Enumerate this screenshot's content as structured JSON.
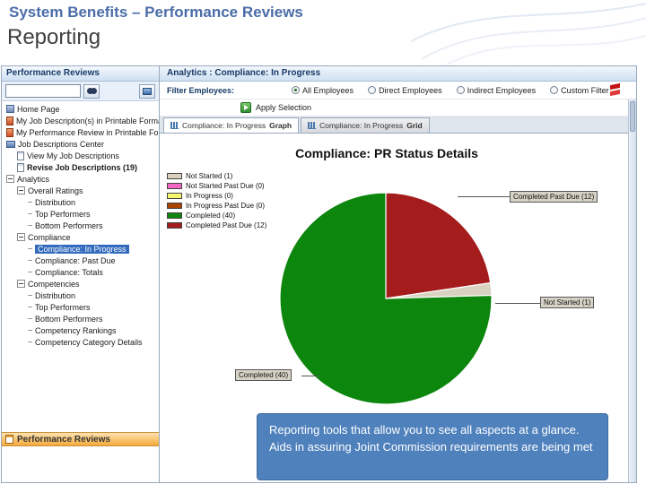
{
  "slide": {
    "title": "System Benefits – Performance Reviews",
    "subtitle": "Reporting",
    "caption": "Reporting tools that allow you to see all aspects at a glance.  Aids in assuring Joint Commission requirements are being met"
  },
  "sidebar": {
    "title": "Performance Reviews",
    "search_value": "",
    "tree": [
      {
        "label": "Home Page",
        "level": 0,
        "icon": "home"
      },
      {
        "label": "My Job Description(s) in Printable Format",
        "level": 0,
        "icon": "doc-red"
      },
      {
        "label": "My Performance Review in Printable Forma",
        "level": 0,
        "icon": "doc-red"
      },
      {
        "label": "Job Descriptions Center",
        "level": 0,
        "icon": "folder"
      },
      {
        "label": "View My Job Descriptions",
        "level": 1,
        "icon": "doc"
      },
      {
        "label": "Revise Job Descriptions (19)",
        "level": 1,
        "icon": "doc",
        "bold": true
      },
      {
        "label": "Analytics",
        "level": 0,
        "icon": "expander"
      },
      {
        "label": "Overall Ratings",
        "level": 1,
        "icon": "expander"
      },
      {
        "label": "Distribution",
        "level": 2,
        "icon": "leaf"
      },
      {
        "label": "Top Performers",
        "level": 2,
        "icon": "leaf"
      },
      {
        "label": "Bottom Performers",
        "level": 2,
        "icon": "leaf"
      },
      {
        "label": "Compliance",
        "level": 1,
        "icon": "expander"
      },
      {
        "label": "Compliance: In Progress",
        "level": 2,
        "icon": "leaf",
        "selected": true
      },
      {
        "label": "Compliance: Past Due",
        "level": 2,
        "icon": "leaf"
      },
      {
        "label": "Compliance: Totals",
        "level": 2,
        "icon": "leaf"
      },
      {
        "label": "Competencies",
        "level": 1,
        "icon": "expander"
      },
      {
        "label": "Distribution",
        "level": 2,
        "icon": "leaf"
      },
      {
        "label": "Top Performers",
        "level": 2,
        "icon": "leaf"
      },
      {
        "label": "Bottom Performers",
        "level": 2,
        "icon": "leaf"
      },
      {
        "label": "Competency Rankings",
        "level": 2,
        "icon": "leaf"
      },
      {
        "label": "Competency Category Details",
        "level": 2,
        "icon": "leaf"
      }
    ],
    "footer": "Performance Reviews"
  },
  "main": {
    "header": "Analytics : Compliance: In Progress",
    "filter_label": "Filter Employees:",
    "filter_options": [
      {
        "label": "All Employees",
        "selected": true
      },
      {
        "label": "Direct Employees",
        "selected": false
      },
      {
        "label": "Indirect Employees",
        "selected": false
      },
      {
        "label": "Custom Filter",
        "selected": false
      }
    ],
    "apply_label": "Apply Selection",
    "tabs": [
      {
        "label": "Compliance: In Progress",
        "view": "Graph",
        "active": true
      },
      {
        "label": "Compliance: In Progress",
        "view": "Grid",
        "active": false
      }
    ]
  },
  "chart_data": {
    "type": "pie",
    "title": "Compliance: PR Status Details",
    "legend_position": "top-left",
    "legend": [
      {
        "label": "Not Started (1)",
        "color": "#d9d2c0"
      },
      {
        "label": "Not Started Past Due (0)",
        "color": "#f266c4"
      },
      {
        "label": "In Progress (0)",
        "color": "#f5f56e"
      },
      {
        "label": "In Progress Past Due (0)",
        "color": "#a84300"
      },
      {
        "label": "Completed (40)",
        "color": "#0d860d"
      },
      {
        "label": "Completed Past Due (12)",
        "color": "#a51c1c"
      }
    ],
    "slices": [
      {
        "label": "Completed Past Due",
        "value": 12,
        "color": "#a51c1c"
      },
      {
        "label": "Not Started",
        "value": 1,
        "color": "#d9d2c0"
      },
      {
        "label": "Completed",
        "value": 40,
        "color": "#0d860d"
      }
    ],
    "callouts": [
      "Completed Past Due (12)",
      "Not Started (1)",
      "Completed (40)"
    ]
  }
}
